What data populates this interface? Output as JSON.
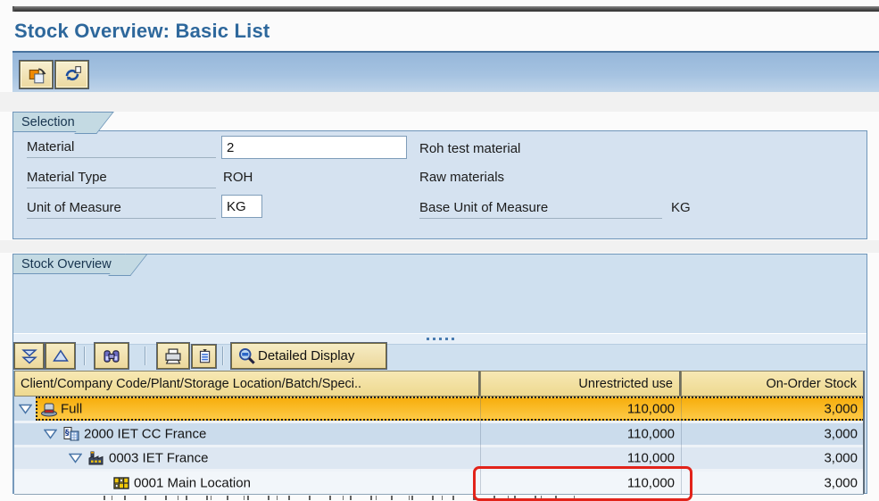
{
  "window": {
    "title": "Stock Overview: Basic List"
  },
  "colors": {
    "title_blue": "#2e689c",
    "panel_bg": "#d5e2f0",
    "tab_bg": "#c4dae3",
    "accent_orange": "#f7ae0d",
    "accent_yellow": "#fdc945",
    "highlight_red": "#e2231a",
    "header_tan": "#f2e0a3"
  },
  "app_toolbar": {
    "buttons": [
      {
        "name": "choose",
        "icon": "choose-icon"
      },
      {
        "name": "refresh",
        "icon": "refresh-icon"
      }
    ]
  },
  "selection": {
    "group_title": "Selection",
    "fields": {
      "material": {
        "label": "Material",
        "value": "2",
        "description": "Roh test material"
      },
      "material_type": {
        "label": "Material Type",
        "value": "ROH",
        "description": "Raw materials"
      },
      "unit_of_measure": {
        "label": "Unit of Measure",
        "value": "KG"
      },
      "base_unit": {
        "label": "Base Unit of Measure",
        "value": "KG"
      }
    }
  },
  "stock_overview": {
    "group_title": "Stock Overview",
    "toolbar": {
      "icons": [
        "sort-descending-icon",
        "sort-ascending-icon",
        "find-icon",
        "print-icon",
        "copy-icon",
        "detailed-display-magnifier-icon"
      ],
      "detailed_display_label": "Detailed Display"
    },
    "table": {
      "columns": [
        "Client/Company Code/Plant/Storage Location/Batch/Speci..",
        "Unrestricted use",
        "On-Order Stock"
      ],
      "rows": [
        {
          "level": 0,
          "icon": "client-hat-icon",
          "label": "Full",
          "unrestricted": "110,000",
          "on_order": "3,000",
          "selected": true
        },
        {
          "level": 1,
          "icon": "company-code-icon",
          "label": "2000 IET CC France",
          "unrestricted": "110,000",
          "on_order": "3,000"
        },
        {
          "level": 2,
          "icon": "plant-icon",
          "label": "0003 IET France",
          "unrestricted": "110,000",
          "on_order": "3,000"
        },
        {
          "level": 3,
          "icon": "storage-location-icon",
          "label": "0001 Main Location",
          "unrestricted": "110,000",
          "on_order": "3,000",
          "annotated": "unrestricted"
        }
      ]
    }
  }
}
